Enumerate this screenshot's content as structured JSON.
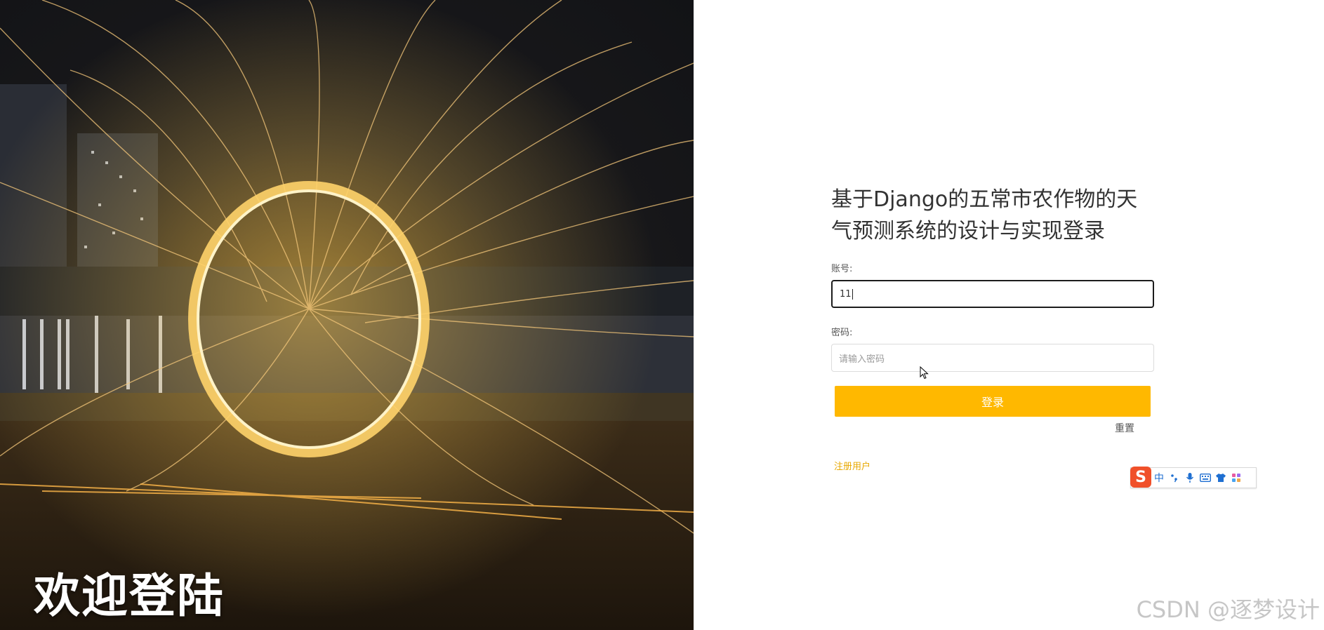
{
  "hero": {
    "welcome_text": "欢迎登陆"
  },
  "form": {
    "title": "基于Django的五常市农作物的天气预测系统的设计与实现登录",
    "account_label": "账号:",
    "account_value": "11",
    "password_label": "密码:",
    "password_placeholder": "请输入密码",
    "login_button": "登录",
    "reset_button": "重置",
    "register_link": "注册用户"
  },
  "ime_toolbar": {
    "logo": "S",
    "mode": "中",
    "items": [
      "punctuation-icon",
      "microphone-icon",
      "keyboard-icon",
      "skin-icon",
      "apps-icon"
    ]
  },
  "watermark": "CSDN @逐梦设计",
  "colors": {
    "primary_button": "#ffb800",
    "link": "#e8a800",
    "ime_logo": "#f0502a"
  }
}
